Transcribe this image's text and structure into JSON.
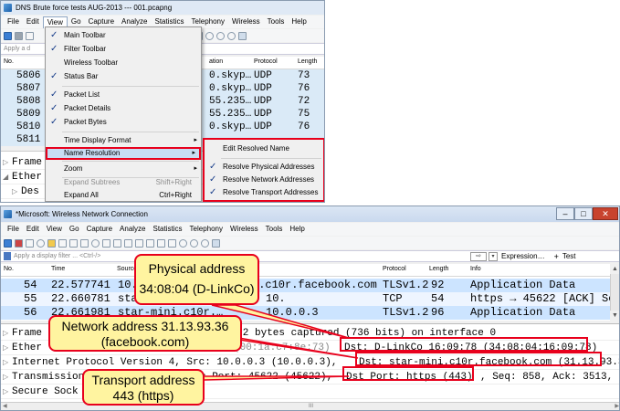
{
  "top_window": {
    "title": "DNS Brute force tests AUG-2013 --- 001.pcapng",
    "menu": [
      "File",
      "Edit",
      "View",
      "Go",
      "Capture",
      "Analyze",
      "Statistics",
      "Telephony",
      "Wireless",
      "Tools",
      "Help"
    ],
    "filter_placeholder": "Apply a d",
    "columns": {
      "no": "No.",
      "destination": "ation",
      "protocol": "Protocol",
      "length": "Length"
    },
    "rows": [
      {
        "no": "5806",
        "dst": "0.skyp…",
        "proto": "UDP",
        "len": "73"
      },
      {
        "no": "5807",
        "dst": "0.skyp…",
        "proto": "UDP",
        "len": "76"
      },
      {
        "no": "5808",
        "dst": "55.235…",
        "proto": "UDP",
        "len": "72"
      },
      {
        "no": "5809",
        "dst": "55.235…",
        "proto": "UDP",
        "len": "75"
      },
      {
        "no": "5810",
        "dst": "0.skyp…",
        "proto": "UDP",
        "len": "76"
      },
      {
        "no": "5811",
        "dst": "",
        "proto": "",
        "len": ""
      }
    ],
    "details": [
      "Frame",
      "Ether",
      "Des"
    ],
    "view_menu": {
      "items": [
        {
          "label": "Main Toolbar",
          "checked": "✓"
        },
        {
          "label": "Filter Toolbar",
          "checked": "✓"
        },
        {
          "label": "Wireless Toolbar",
          "checked": ""
        },
        {
          "label": "Status Bar",
          "checked": "✓"
        },
        {
          "label": "Packet List",
          "checked": "✓"
        },
        {
          "label": "Packet Details",
          "checked": "✓"
        },
        {
          "label": "Packet Bytes",
          "checked": "✓"
        },
        {
          "label": "Time Display Format",
          "arrow": "▸"
        },
        {
          "label": "Name Resolution",
          "arrow": "▸"
        },
        {
          "label": "Zoom",
          "arrow": "▸"
        },
        {
          "label": "Expand Subtrees",
          "shortcut": "Shift+Right"
        },
        {
          "label": "Expand All",
          "shortcut": "Ctrl+Right"
        }
      ]
    },
    "name_resolution_menu": [
      {
        "label": "Edit Resolved Name",
        "checked": ""
      },
      {
        "label": "Resolve Physical Addresses",
        "checked": "✓"
      },
      {
        "label": "Resolve Network Addresses",
        "checked": "✓"
      },
      {
        "label": "Resolve Transport Addresses",
        "checked": "✓"
      }
    ]
  },
  "bottom_window": {
    "title": "*Microsoft: Wireless Network Connection",
    "menu": [
      "File",
      "Edit",
      "View",
      "Go",
      "Capture",
      "Analyze",
      "Statistics",
      "Telephony",
      "Wireless",
      "Tools",
      "Help"
    ],
    "filter_placeholder": "Apply a display filter ... <Ctrl-/>",
    "expression_label": "Expression…",
    "plus_label": "+",
    "test_label": "Test",
    "columns": {
      "no": "No.",
      "time": "Time",
      "source": "Source",
      "protocol": "Protocol",
      "length": "Length",
      "info": "Info"
    },
    "rows": [
      {
        "no": "54",
        "time": "22.577741",
        "src": "10.",
        "dst": "i.c10r.facebook.com",
        "proto": "TLSv1.2",
        "len": "92",
        "info": "Application Data"
      },
      {
        "no": "55",
        "time": "22.660781",
        "src": "star-mini.c10r.…",
        "dst": "10.",
        "proto": "TCP",
        "len": "54",
        "info": "https → 45622 [ACK] Se…"
      },
      {
        "no": "56",
        "time": "22.661981",
        "src": "star-mini.c10r.…",
        "dst": "10.0.0.3",
        "proto": "TLSv1.2",
        "len": "96",
        "info": "Application Data"
      }
    ],
    "details": [
      {
        "left": "Frame",
        "right": ", 92 bytes captured (736 bits) on interface 0"
      },
      {
        "left": "Ether",
        "mid": "(00:1a:c7:8e:73)",
        "right": "Dst: D-LinkCo_16:09:78 (34:08:04:16:09:78)"
      },
      {
        "left": "Internet Protocol Version 4, Src: 10.0.0.3 (10.0.0.3),",
        "right": "Dst: star-mini.c10r.facebook.com (31.13.93.36)"
      },
      {
        "left": "Transmission",
        "mid": "c Port: 45622 (45622),",
        "right": "Dst Port: https (443)",
        "tail": ", Seq: 858, Ack: 3513, Len:"
      },
      {
        "left": "Secure Sock"
      }
    ],
    "scroll_label": "III"
  },
  "callouts": {
    "physical": [
      "Physical address",
      "34:08:04 (D-LinkCo)"
    ],
    "network": [
      "Network address 31.13.93.36",
      "(facebook.com)"
    ],
    "transport": [
      "Transport address",
      "443 (https)"
    ]
  },
  "colors": {
    "highlight_row": "#cce4ff",
    "accent_red": "#e8001c",
    "callout_fill": "#fff4a0"
  }
}
